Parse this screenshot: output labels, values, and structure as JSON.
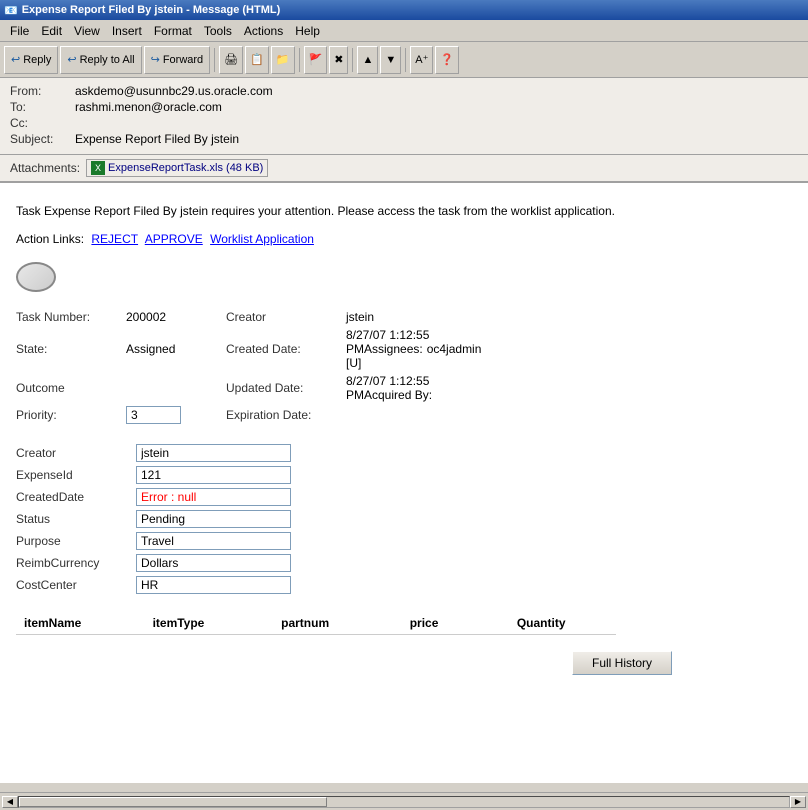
{
  "window": {
    "title": "Expense Report Filed By jstein - Message (HTML)",
    "icon": "📧"
  },
  "menu": {
    "items": [
      "File",
      "Edit",
      "View",
      "Insert",
      "Format",
      "Tools",
      "Actions",
      "Help"
    ]
  },
  "toolbar": {
    "buttons": [
      {
        "id": "reply",
        "label": "Reply",
        "icon": "↩"
      },
      {
        "id": "reply-all",
        "label": "Reply to All",
        "icon": "↩↩"
      },
      {
        "id": "forward",
        "label": "Forward",
        "icon": "↪"
      }
    ]
  },
  "email": {
    "from": "askdemo@usunnbc29.us.oracle.com",
    "to": "rashmi.menon@oracle.com",
    "cc": "",
    "subject": "Expense Report Filed By jstein",
    "attachment": {
      "name": "ExpenseReportTask.xls (48 KB)",
      "icon": "X"
    }
  },
  "labels": {
    "from": "From:",
    "to": "To:",
    "cc": "Cc:",
    "subject": "Subject:",
    "attachments": "Attachments:"
  },
  "body": {
    "notification": "Task Expense Report Filed By jstein requires your attention. Please access the task from the worklist application.",
    "action_links_label": "Action Links:",
    "action_links": [
      "REJECT",
      "APPROVE",
      "Worklist Application"
    ]
  },
  "task": {
    "number_label": "Task Number:",
    "number_value": "200002",
    "state_label": "State:",
    "state_value": "Assigned",
    "outcome_label": "Outcome",
    "priority_label": "Priority:",
    "priority_value": "3",
    "creator_label": "Creator",
    "creator_value": "jstein",
    "created_date_label": "Created Date:",
    "created_date_value": "8/27/07 1:12:55 PM",
    "updated_date_label": "Updated Date:",
    "updated_date_value": "8/27/07 1:12:55 PM",
    "assignees_label": "Assignees:",
    "assignees_value": "oc4jadmin [U]",
    "acquired_by_label": "Acquired By:",
    "acquired_by_value": "",
    "expiration_date_label": "Expiration Date:",
    "expiration_date_value": ""
  },
  "form": {
    "fields": [
      {
        "label": "Creator",
        "value": "jstein",
        "error": false
      },
      {
        "label": "ExpenseId",
        "value": "121",
        "error": false
      },
      {
        "label": "CreatedDate",
        "value": "Error : null",
        "error": true
      },
      {
        "label": "Status",
        "value": "Pending",
        "error": false
      },
      {
        "label": "Purpose",
        "value": "Travel",
        "error": false
      },
      {
        "label": "ReimbCurrency",
        "value": "Dollars",
        "error": false
      },
      {
        "label": "CostCenter",
        "value": "HR",
        "error": false
      }
    ]
  },
  "items_table": {
    "columns": [
      "itemName",
      "itemType",
      "partnum",
      "price",
      "Quantity"
    ]
  },
  "buttons": {
    "full_history": "Full History"
  }
}
